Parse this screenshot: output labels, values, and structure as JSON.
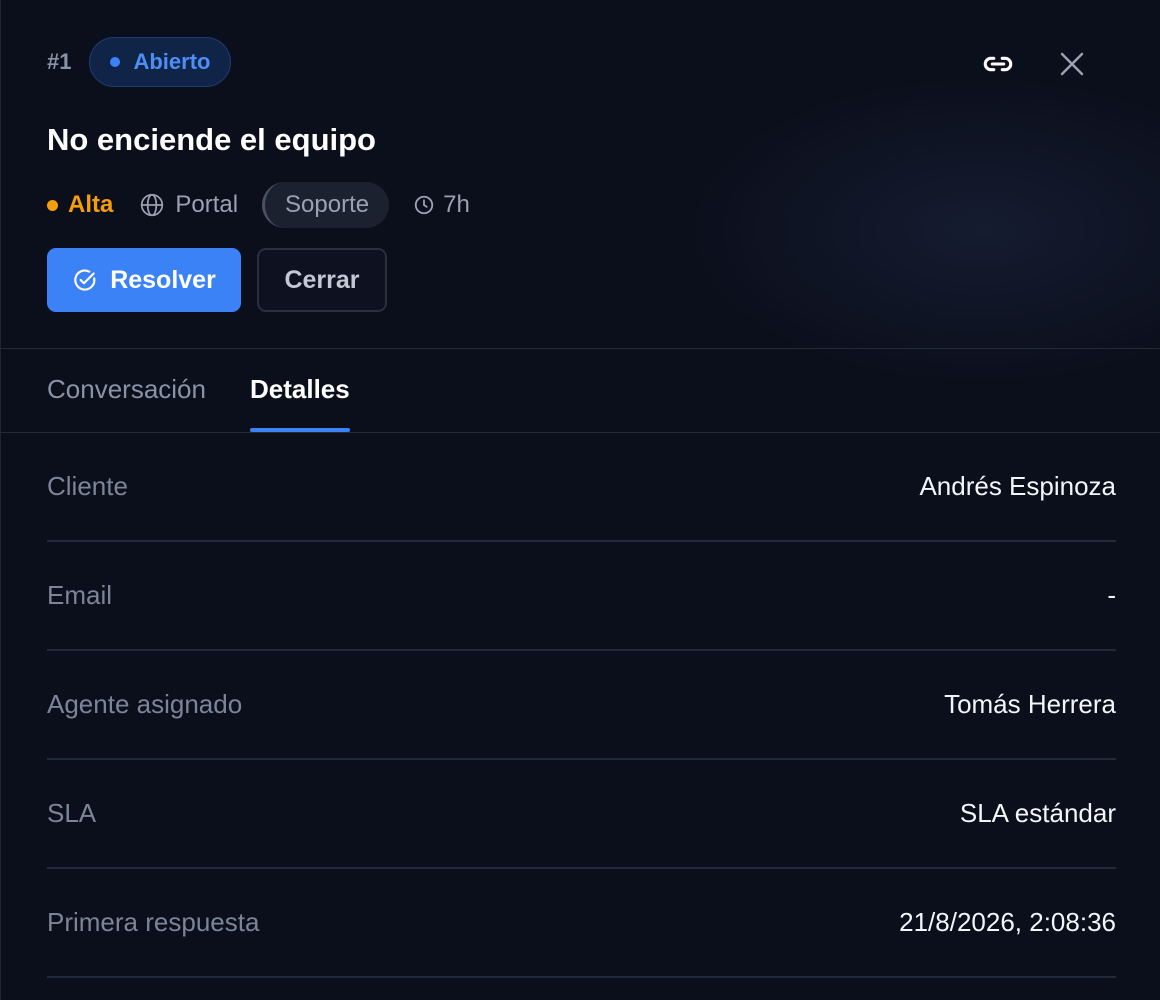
{
  "ticket": {
    "id": "#1",
    "status": "Abierto",
    "title": "No enciende el equipo",
    "priority": "Alta",
    "channel": "Portal",
    "team": "Soporte",
    "age": "7h"
  },
  "icons": {
    "link": "link-icon",
    "close": "close-icon",
    "channel": "globe-icon",
    "age": "clock-icon",
    "resolve": "check-circle-icon"
  },
  "actions": {
    "resolve_label": "Resolver",
    "close_label": "Cerrar"
  },
  "tabs": [
    {
      "label": "Conversación",
      "active": false
    },
    {
      "label": "Detalles",
      "active": true
    }
  ],
  "details": [
    {
      "label": "Cliente",
      "value": "Andrés Espinoza"
    },
    {
      "label": "Email",
      "value": "-"
    },
    {
      "label": "Agente asignado",
      "value": "Tomás Herrera"
    },
    {
      "label": "SLA",
      "value": "SLA estándar"
    },
    {
      "label": "Primera respuesta",
      "value": "21/8/2026, 2:08:36"
    }
  ],
  "colors": {
    "background": "#0b0f1c",
    "accent": "#3b82f6",
    "priority_high": "#f59e0b",
    "status_open": "#4d8ef7"
  }
}
